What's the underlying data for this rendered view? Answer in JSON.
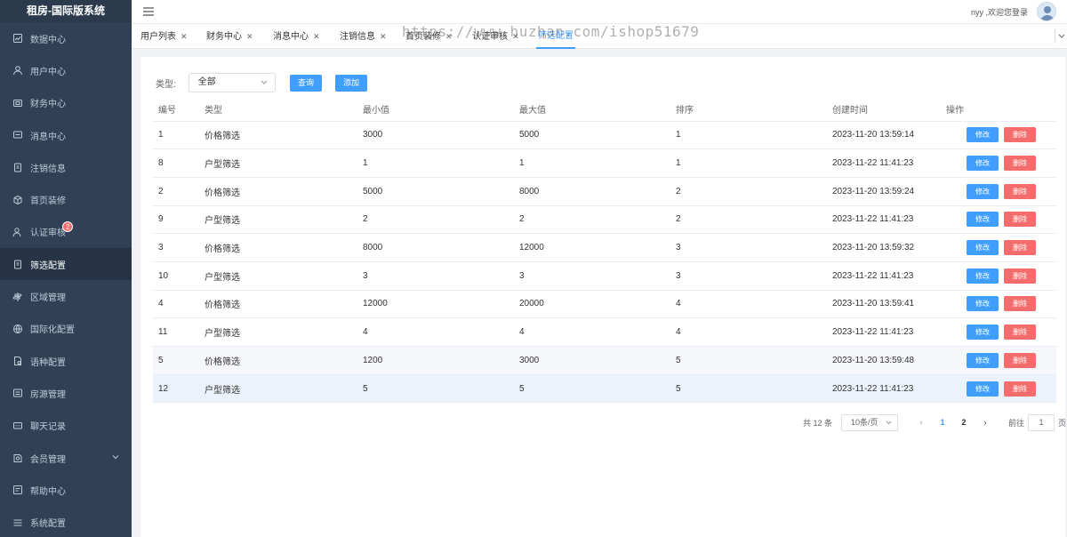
{
  "app": {
    "title": "租房-国际版系统"
  },
  "sidebar": {
    "items": [
      {
        "label": "数据中心",
        "icon": "chart-icon"
      },
      {
        "label": "用户中心",
        "icon": "user-icon"
      },
      {
        "label": "财务中心",
        "icon": "wallet-icon"
      },
      {
        "label": "消息中心",
        "icon": "message-icon"
      },
      {
        "label": "注销信息",
        "icon": "clipboard-icon"
      },
      {
        "label": "首页装修",
        "icon": "cube-icon"
      },
      {
        "label": "认证审核",
        "icon": "user-check-icon",
        "badge": "2"
      },
      {
        "label": "筛选配置",
        "icon": "clipboard-icon",
        "active": true
      },
      {
        "label": "区域管理",
        "icon": "signpost-icon"
      },
      {
        "label": "国际化配置",
        "icon": "globe-icon"
      },
      {
        "label": "语种配置",
        "icon": "document-icon"
      },
      {
        "label": "房源管理",
        "icon": "house-icon"
      },
      {
        "label": "聊天记录",
        "icon": "chat-icon"
      },
      {
        "label": "会员管理",
        "icon": "member-icon",
        "expandable": true
      },
      {
        "label": "帮助中心",
        "icon": "help-icon"
      },
      {
        "label": "系统配置",
        "icon": "list-icon"
      }
    ]
  },
  "header": {
    "welcome": "nyy ,欢迎您登录"
  },
  "tags": [
    {
      "label": "用户列表",
      "closable": true
    },
    {
      "label": "财务中心",
      "closable": true
    },
    {
      "label": "消息中心",
      "closable": true
    },
    {
      "label": "注销信息",
      "closable": true
    },
    {
      "label": "首页装修",
      "closable": true
    },
    {
      "label": "认证审核",
      "closable": true
    },
    {
      "label": "筛选配置",
      "closable": false,
      "active": true
    }
  ],
  "watermark": "https://www.huzhan.com/ishop51679",
  "filter": {
    "type_label": "类型:",
    "type_value": "全部",
    "query_label": "查询",
    "add_label": "添加"
  },
  "table": {
    "headers": [
      "编号",
      "类型",
      "最小值",
      "最大值",
      "排序",
      "创建时间",
      "操作"
    ],
    "edit_label": "修改",
    "delete_label": "删除",
    "rows": [
      [
        "1",
        "价格筛选",
        "3000",
        "5000",
        "1",
        "2023-11-20 13:59:14"
      ],
      [
        "8",
        "户型筛选",
        "1",
        "1",
        "1",
        "2023-11-22 11:41:23"
      ],
      [
        "2",
        "价格筛选",
        "5000",
        "8000",
        "2",
        "2023-11-20 13:59:24"
      ],
      [
        "9",
        "户型筛选",
        "2",
        "2",
        "2",
        "2023-11-22 11:41:23"
      ],
      [
        "3",
        "价格筛选",
        "8000",
        "12000",
        "3",
        "2023-11-20 13:59:32"
      ],
      [
        "10",
        "户型筛选",
        "3",
        "3",
        "3",
        "2023-11-22 11:41:23"
      ],
      [
        "4",
        "价格筛选",
        "12000",
        "20000",
        "4",
        "2023-11-20 13:59:41"
      ],
      [
        "11",
        "户型筛选",
        "4",
        "4",
        "4",
        "2023-11-22 11:41:23"
      ],
      [
        "5",
        "价格筛选",
        "1200",
        "3000",
        "5",
        "2023-11-20 13:59:48"
      ],
      [
        "12",
        "户型筛选",
        "5",
        "5",
        "5",
        "2023-11-22 11:41:23"
      ]
    ]
  },
  "pagination": {
    "total": "共 12 条",
    "page_size": "10条/页",
    "prev": "‹",
    "next": "›",
    "pages": [
      "1",
      "2"
    ],
    "current": "1",
    "goto_prefix": "前往",
    "goto_value": "1",
    "goto_suffix": "页"
  },
  "colors": {
    "sidebar_bg": "#304156",
    "primary": "#409eff",
    "danger": "#f56c6c"
  }
}
